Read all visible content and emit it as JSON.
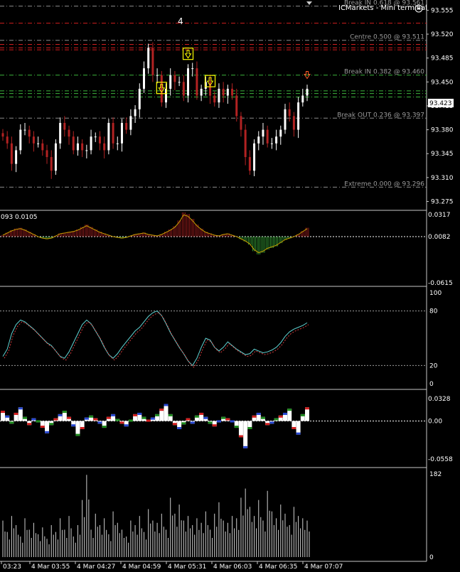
{
  "terminal": {
    "title": "ICMarkets - Mini terminal",
    "counter": "4",
    "current_price": "93.423"
  },
  "colors": {
    "background": "#000000",
    "panel_border": "#c8c8c8",
    "axis_text": "#ffffff",
    "level_text": "#9a9a9a",
    "bull_candle": "#ffffff",
    "bear_candle": "#b22222",
    "arrow_box": "#ffff00",
    "price_tag_bg": "#ffffff"
  },
  "price_axis": {
    "ticks": [
      "93.555",
      "93.520",
      "93.485",
      "93.450",
      "93.415",
      "93.380",
      "93.345",
      "93.310",
      "93.275"
    ]
  },
  "levels": [
    {
      "label": "Break IN 0.618 @ 93.561",
      "price": 93.561,
      "color": "#8c8c8c"
    },
    {
      "label": "",
      "price": 93.536,
      "color": "#d21e1e"
    },
    {
      "label": "Centre 0.500 @ 93.511",
      "price": 93.511,
      "color": "#8c8c8c"
    },
    {
      "label": "",
      "price": 93.505,
      "color": "#d21e1e"
    },
    {
      "label": "",
      "price": 93.5,
      "color": "#d21e1e"
    },
    {
      "label": "",
      "price": 93.497,
      "color": "#d21e1e"
    },
    {
      "label": "Break IN 0.382 @ 93.460",
      "price": 93.46,
      "color": "#3cb43c"
    },
    {
      "label": "",
      "price": 93.437,
      "color": "#3cb43c"
    },
    {
      "label": "",
      "price": 93.433,
      "color": "#3cb43c"
    },
    {
      "label": "",
      "price": 93.428,
      "color": "#3cb43c"
    },
    {
      "label": "Break OUT 0.236 @ 93.397",
      "price": 93.397,
      "color": "#8c8c8c"
    },
    {
      "label": "Extreme 0.000 @ 93.296",
      "price": 93.296,
      "color": "#8c8c8c"
    }
  ],
  "price_closes": [
    93.37,
    93.36,
    93.33,
    93.35,
    93.38,
    93.38,
    93.37,
    93.36,
    93.36,
    93.35,
    93.34,
    93.32,
    93.36,
    93.39,
    93.38,
    93.37,
    93.35,
    93.36,
    93.35,
    93.35,
    93.37,
    93.37,
    93.36,
    93.35,
    93.39,
    93.36,
    93.36,
    93.39,
    93.38,
    93.4,
    93.41,
    93.44,
    93.47,
    93.5,
    93.46,
    93.46,
    93.42,
    93.44,
    93.46,
    93.45,
    93.45,
    93.43,
    93.47,
    93.47,
    93.43,
    93.44,
    93.45,
    93.43,
    93.42,
    93.44,
    93.43,
    93.44,
    93.43,
    93.4,
    93.38,
    93.34,
    93.32,
    93.36,
    93.37,
    93.38,
    93.36,
    93.36,
    93.37,
    93.38,
    93.41,
    93.4,
    93.38,
    93.42,
    93.43,
    93.44
  ],
  "arrows": [
    {
      "bar": 36,
      "direction": "down"
    },
    {
      "bar": 42,
      "direction": "down"
    },
    {
      "bar": 47,
      "direction": "down"
    },
    {
      "bar": 69,
      "direction": "down-small"
    }
  ],
  "macd": {
    "params_label": "093 0.0105",
    "ticks": [
      "0.0317",
      "0.0082",
      "-0.0615"
    ],
    "values": [
      0.002,
      0.005,
      0.008,
      0.01,
      0.011,
      0.009,
      0.006,
      0.003,
      0.0,
      -0.002,
      -0.003,
      -0.002,
      0.001,
      0.004,
      0.005,
      0.006,
      0.007,
      0.009,
      0.012,
      0.015,
      0.012,
      0.009,
      0.006,
      0.004,
      0.002,
      0.0,
      -0.001,
      -0.002,
      -0.001,
      0.001,
      0.003,
      0.004,
      0.005,
      0.003,
      0.002,
      0.001,
      0.003,
      0.006,
      0.009,
      0.013,
      0.02,
      0.03,
      0.028,
      0.022,
      0.015,
      0.01,
      0.006,
      0.004,
      0.002,
      0.001,
      0.003,
      0.004,
      0.002,
      0.0,
      -0.003,
      -0.006,
      -0.01,
      -0.018,
      -0.022,
      -0.02,
      -0.016,
      -0.014,
      -0.012,
      -0.008,
      -0.004,
      -0.002,
      0.0,
      0.003,
      0.007,
      0.011
    ]
  },
  "stochastic": {
    "ticks": [
      "100",
      "80",
      "20",
      "0"
    ],
    "values": [
      30,
      38,
      55,
      65,
      70,
      68,
      64,
      60,
      55,
      50,
      45,
      42,
      36,
      30,
      28,
      35,
      45,
      55,
      65,
      70,
      66,
      58,
      50,
      40,
      32,
      28,
      33,
      40,
      46,
      52,
      58,
      62,
      68,
      74,
      78,
      80,
      75,
      66,
      56,
      48,
      40,
      33,
      25,
      20,
      28,
      40,
      50,
      48,
      40,
      36,
      40,
      46,
      42,
      38,
      35,
      32,
      33,
      38,
      36,
      34,
      35,
      37,
      40,
      45,
      52,
      57,
      60,
      62,
      64,
      67
    ]
  },
  "histogram": {
    "ticks": [
      "0.0328",
      "0.00",
      "-0.0558"
    ],
    "values": [
      0.015,
      0.008,
      -0.004,
      0.012,
      0.02,
      0.006,
      -0.006,
      0.004,
      -0.002,
      -0.01,
      -0.018,
      -0.006,
      0.004,
      0.01,
      0.015,
      0.006,
      -0.008,
      -0.022,
      -0.012,
      0.005,
      0.008,
      0.004,
      -0.004,
      -0.01,
      0.006,
      0.01,
      0.003,
      -0.004,
      -0.008,
      0.002,
      0.01,
      0.012,
      0.006,
      0.002,
      0.005,
      0.01,
      0.018,
      0.025,
      0.01,
      -0.006,
      -0.012,
      -0.005,
      0.004,
      -0.004,
      0.008,
      0.012,
      0.006,
      -0.004,
      -0.008,
      -0.002,
      0.006,
      0.004,
      0.001,
      -0.01,
      -0.024,
      -0.04,
      -0.012,
      0.008,
      0.012,
      0.006,
      -0.006,
      -0.004,
      0.004,
      0.008,
      0.012,
      0.018,
      -0.012,
      -0.02,
      0.01,
      0.02
    ]
  },
  "volume": {
    "ticks": [
      "182",
      "0"
    ],
    "values": [
      80,
      55,
      90,
      70,
      45,
      85,
      60,
      75,
      50,
      65,
      40,
      70,
      55,
      85,
      60,
      90,
      45,
      70,
      125,
      180,
      60,
      95,
      70,
      85,
      50,
      100,
      75,
      60,
      45,
      80,
      70,
      90,
      55,
      105,
      80,
      75,
      95,
      60,
      130,
      95,
      115,
      80,
      90,
      70,
      85,
      75,
      100,
      60,
      95,
      120,
      80,
      75,
      90,
      85,
      130,
      150,
      110,
      90,
      125,
      80,
      145,
      100,
      85,
      115,
      95,
      70,
      110,
      90,
      85,
      80
    ]
  },
  "time_axis": {
    "labels": [
      "03:23",
      "4 Mar 03:55",
      "4 Mar 04:27",
      "4 Mar 04:59",
      "4 Mar 05:31",
      "4 Mar 06:03",
      "4 Mar 06:35",
      "4 Mar 07:07"
    ]
  }
}
